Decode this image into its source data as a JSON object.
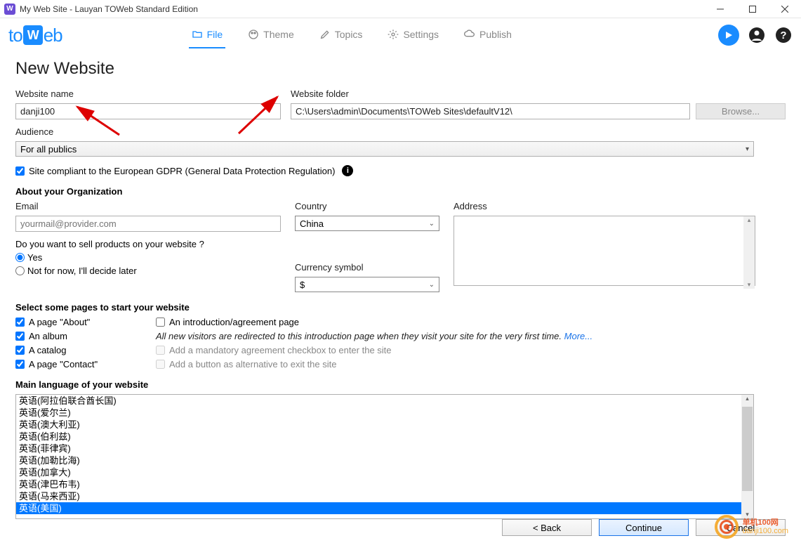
{
  "window": {
    "title": "My Web Site - Lauyan TOWeb Standard Edition"
  },
  "logo": {
    "pre": "to",
    "mid": "W",
    "post": "eb"
  },
  "tabs": {
    "file": "File",
    "theme": "Theme",
    "topics": "Topics",
    "settings": "Settings",
    "publish": "Publish"
  },
  "page": {
    "title": "New Website"
  },
  "fields": {
    "website_name_label": "Website name",
    "website_name_value": "danji100",
    "website_folder_label": "Website folder",
    "website_folder_value": "C:\\Users\\admin\\Documents\\TOWeb Sites\\defaultV12\\",
    "browse": "Browse...",
    "audience_label": "Audience",
    "audience_value": "For all publics",
    "gdpr": "Site compliant to the European GDPR (General Data Protection Regulation)"
  },
  "org": {
    "heading": "About your Organization",
    "email_label": "Email",
    "email_placeholder": "yourmail@provider.com",
    "country_label": "Country",
    "country_value": "China",
    "address_label": "Address",
    "sell_q": "Do you want to sell products on your website ?",
    "yes": "Yes",
    "no": "Not for now, I'll decide later",
    "currency_label": "Currency symbol",
    "currency_value": "$"
  },
  "pages": {
    "heading": "Select some pages to start your website",
    "about": "A page \"About\"",
    "album": "An album",
    "catalog": "A catalog",
    "contact": "A page \"Contact\"",
    "intro": "An introduction/agreement page",
    "intro_hint": "All new visitors are redirected to this introduction page when they visit your site for the very first time. ",
    "more": "More...",
    "mandatory": "Add a mandatory agreement checkbox to enter the site",
    "exit_btn": "Add a button as alternative to exit the site"
  },
  "lang": {
    "heading": "Main language of your website",
    "items": [
      "英语(阿拉伯联合酋长国)",
      "英语(爱尔兰)",
      "英语(澳大利亚)",
      "英语(伯利兹)",
      "英语(菲律宾)",
      "英语(加勒比海)",
      "英语(加拿大)",
      "英语(津巴布韦)",
      "英语(马来西亚)",
      "英语(美国)"
    ],
    "selected_index": 9
  },
  "footer": {
    "back": "<  Back",
    "continue": "Continue",
    "cancel": "Cancel"
  },
  "watermark": {
    "cn": "单机100网",
    "en": "danji100.com"
  }
}
